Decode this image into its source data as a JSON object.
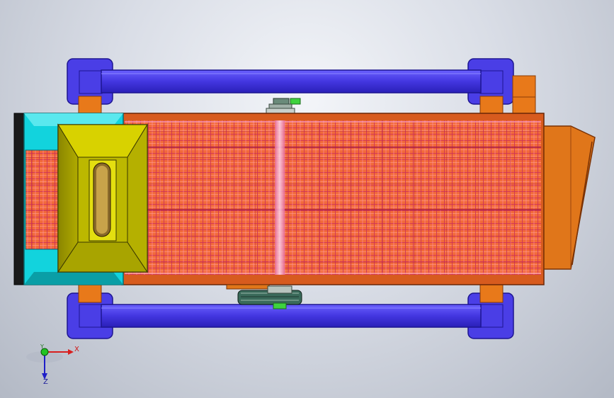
{
  "colors": {
    "frame": "#4a3ee6",
    "frame_dark": "#1d1590",
    "bracket": "#e8791a",
    "hopper_side": "#12d3dd",
    "hopper": "#c6c200",
    "belt": "#f05a2e",
    "shaft": "#f2b2d2",
    "chute": "#e0761a",
    "pulley": "#3a6a5a"
  },
  "triad": {
    "x_label": "X",
    "y_label": "Y",
    "z_label": "Z"
  }
}
